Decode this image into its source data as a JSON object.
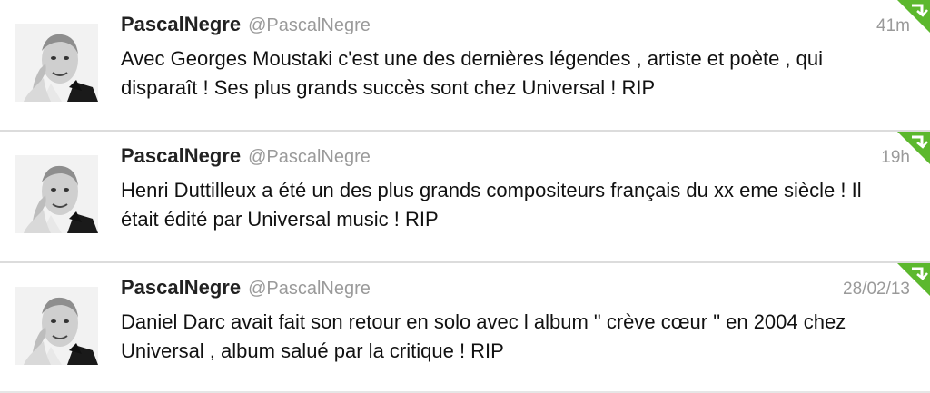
{
  "tweets": [
    {
      "name": "PascalNegre",
      "handle": "@PascalNegre",
      "time": "41m",
      "text": "Avec Georges Moustaki c'est une des dernières légendes , artiste et poète , qui disparaît ! Ses plus grands succès sont chez Universal ! RIP"
    },
    {
      "name": "PascalNegre",
      "handle": "@PascalNegre",
      "time": "19h",
      "text": "Henri Duttilleux a été un des plus grands compositeurs français du xx eme siècle ! Il était édité par Universal music ! RIP"
    },
    {
      "name": "PascalNegre",
      "handle": "@PascalNegre",
      "time": "28/02/13",
      "text": "Daniel Darc avait fait son retour en solo avec l album \" crève cœur \" en 2004 chez Universal , album salué par la critique ! RIP"
    }
  ],
  "colors": {
    "retweet_corner": "#5cb82e",
    "meta_text": "#9a9a9a",
    "divider": "#dcdcdc"
  },
  "icons": {
    "corner": "retweet-corner-icon",
    "avatar": "avatar"
  }
}
